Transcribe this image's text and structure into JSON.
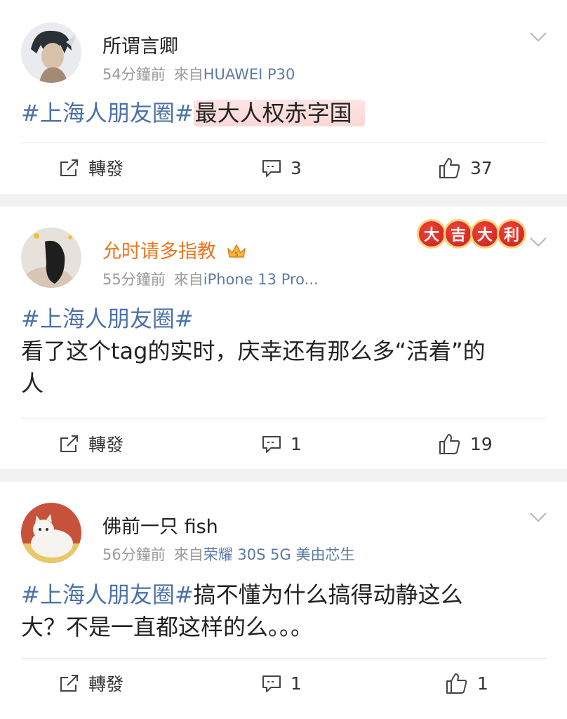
{
  "posts": [
    {
      "username": "所谓言卿",
      "time": "54分鐘前",
      "from_label": "來自",
      "source": "HUAWEI P30",
      "hashtag": "#上海人朋友圈#",
      "highlight": "最大人权赤字国",
      "repost_label": "轉發",
      "comments": "3",
      "likes": "37"
    },
    {
      "username": "允时请多指教",
      "time": "55分鐘前",
      "from_label": "來自",
      "source": "iPhone 13 Pro...",
      "hashtag": "#上海人朋友圈#",
      "body_line1": "看了这个tag的实时，庆幸还有那么多“活着”的",
      "body_line2": "人",
      "badges": [
        "大",
        "吉",
        "大",
        "利"
      ],
      "repost_label": "轉發",
      "comments": "1",
      "likes": "19"
    },
    {
      "username": "佛前一只 fish",
      "time": "56分鐘前",
      "from_label": "來自",
      "source": "荣耀 30S 5G 美由芯生",
      "hashtag": "#上海人朋友圈#",
      "body_line1": "搞不懂为什么搞得动静这么",
      "body_line2": "大？不是一直都这样的么。。。",
      "repost_label": "轉發",
      "comments": "1",
      "likes": "1"
    }
  ],
  "colors": {
    "link": "#4c71a8",
    "vip_name": "#f0731e",
    "meta": "#9a9a9a",
    "source": "#5c7aa3"
  }
}
